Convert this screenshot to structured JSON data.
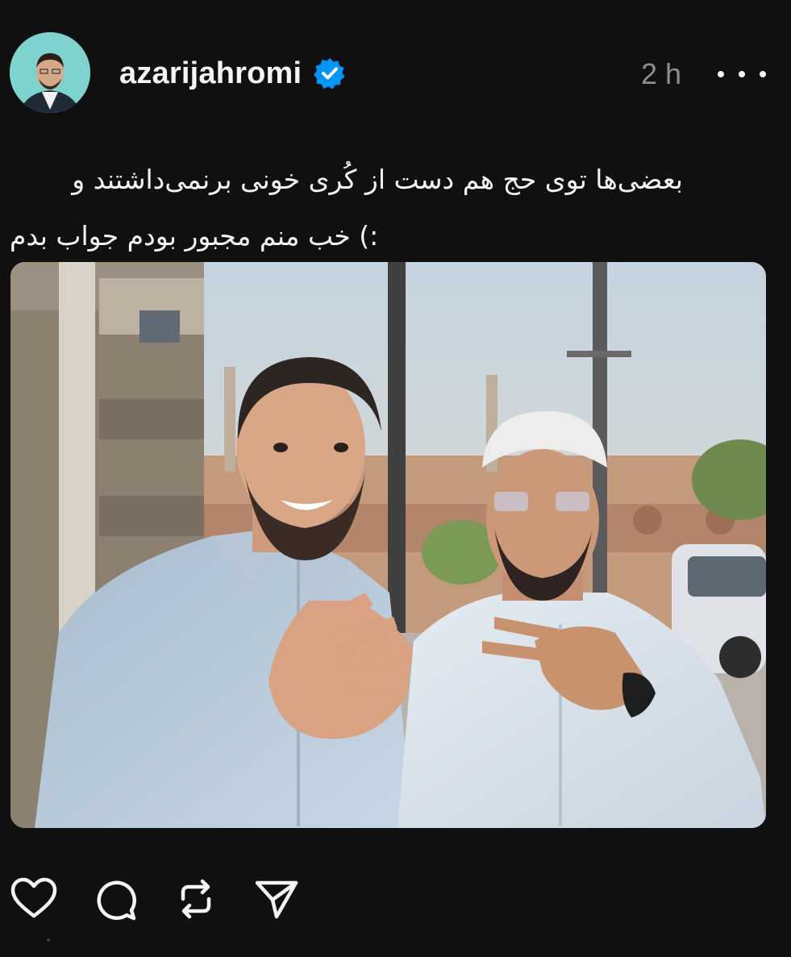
{
  "post": {
    "username": "azarijahromi",
    "verified": true,
    "time": "2 h",
    "caption_lines": [
      "بعضی‌ها توی حج هم دست از کُری خونی برنمی‌داشتند و",
      ":) خب منم مجبور بودم جواب بدم"
    ]
  },
  "icons": {
    "avatar": "profile-avatar",
    "verified": "verified-badge-icon",
    "more": "more-options-icon",
    "like": "heart-icon",
    "comment": "comment-icon",
    "repost": "repost-icon",
    "share": "send-icon"
  },
  "colors": {
    "background": "#101010",
    "text": "#f3f5f7",
    "muted": "#8a8d91",
    "verified_blue": "#0095f6"
  }
}
